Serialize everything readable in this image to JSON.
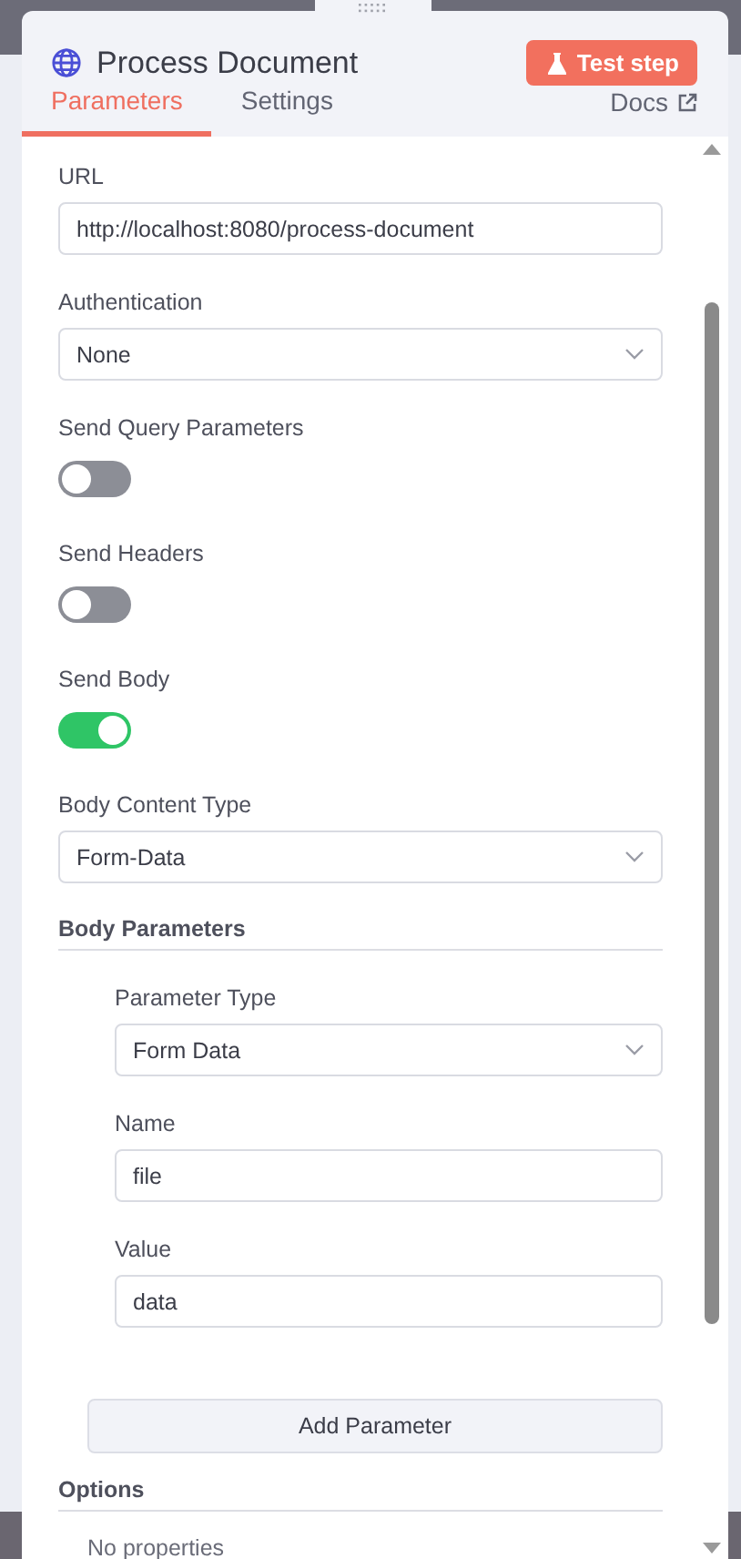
{
  "header": {
    "title": "Process Document",
    "test_button": "Test step"
  },
  "tabs": [
    {
      "label": "Parameters",
      "selected": true
    },
    {
      "label": "Settings",
      "selected": false
    }
  ],
  "docs_link": "Docs",
  "fields": [
    {
      "kind": "text",
      "label": "URL",
      "value": "http://localhost:8080/process-document"
    },
    {
      "kind": "select",
      "label": "Authentication",
      "value": "None"
    },
    {
      "kind": "toggle",
      "label": "Send Query Parameters",
      "on": false
    },
    {
      "kind": "toggle",
      "label": "Send Headers",
      "on": false
    },
    {
      "kind": "toggle",
      "label": "Send Body",
      "on": true
    },
    {
      "kind": "select",
      "label": "Body Content Type",
      "value": "Form-Data"
    }
  ],
  "body_parameters": {
    "title": "Body Parameters",
    "fields": [
      {
        "kind": "select",
        "label": "Parameter Type",
        "value": "Form Data"
      },
      {
        "kind": "text",
        "label": "Name",
        "value": "file"
      },
      {
        "kind": "text",
        "label": "Value",
        "value": "data"
      }
    ],
    "add_button": "Add Parameter"
  },
  "options": {
    "title": "Options",
    "empty_text": "No properties"
  }
}
